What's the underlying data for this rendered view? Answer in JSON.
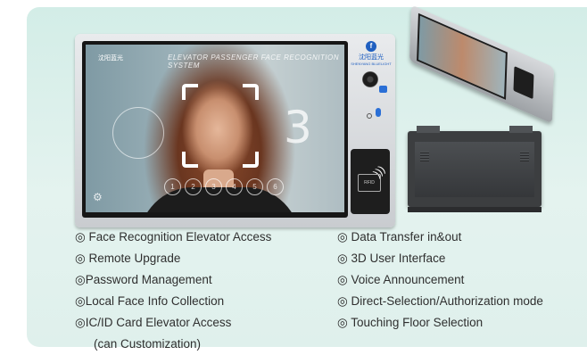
{
  "device": {
    "brand_cn": "沈阳蓝光",
    "brand_en": "SHENYANG BLUELIGHT",
    "screen_title": "ELEVATOR PASSENGER FACE RECOGNITION SYSTEM",
    "countdown": "3",
    "floor_buttons": [
      "1",
      "2",
      "3",
      "4",
      "5",
      "6"
    ],
    "rfid_label": "RFID"
  },
  "features": {
    "left": [
      "◎ Face Recognition Elevator Access",
      "◎ Remote Upgrade",
      "◎Password Management",
      "◎Local Face Info Collection",
      "◎IC/ID Card Elevator Access",
      "(can Customization)"
    ],
    "right": [
      "◎ Data Transfer in&out",
      "◎ 3D User Interface",
      "◎ Voice Announcement",
      "◎ Direct-Selection/Authorization mode",
      "◎ Touching Floor Selection"
    ]
  },
  "colors": {
    "panel_bg": "#d3ede7",
    "brand_blue": "#1f5fc0",
    "text": "#2f2f2f"
  }
}
